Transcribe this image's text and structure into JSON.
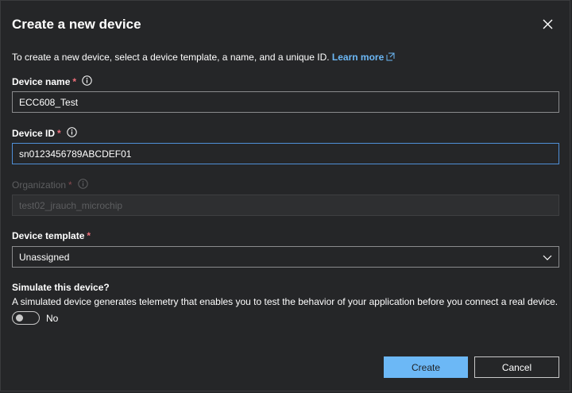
{
  "dialog": {
    "title": "Create a new device",
    "intro_text": "To create a new device, select a device template, a name, and a unique ID.",
    "learn_more": "Learn more"
  },
  "fields": {
    "device_name": {
      "label": "Device name",
      "required_mark": "*",
      "value": "ECC608_Test"
    },
    "device_id": {
      "label": "Device ID",
      "required_mark": "*",
      "value": "sn0123456789ABCDEF01"
    },
    "organization": {
      "label": "Organization",
      "required_mark": "*",
      "value": "test02_jrauch_microchip"
    },
    "device_template": {
      "label": "Device template",
      "required_mark": "*",
      "value": "Unassigned"
    }
  },
  "simulate": {
    "heading": "Simulate this device?",
    "description": "A simulated device generates telemetry that enables you to test the behavior of your application before you connect a real device.",
    "toggle_label": "No",
    "toggle_on": false
  },
  "buttons": {
    "create": "Create",
    "cancel": "Cancel"
  },
  "colors": {
    "background": "#252628",
    "accent": "#6cb8f6",
    "required": "#f1707b",
    "focus_border": "#4f8fd8"
  },
  "icons": [
    "close-icon",
    "external-link-icon",
    "info-icon",
    "chevron-down-icon"
  ]
}
